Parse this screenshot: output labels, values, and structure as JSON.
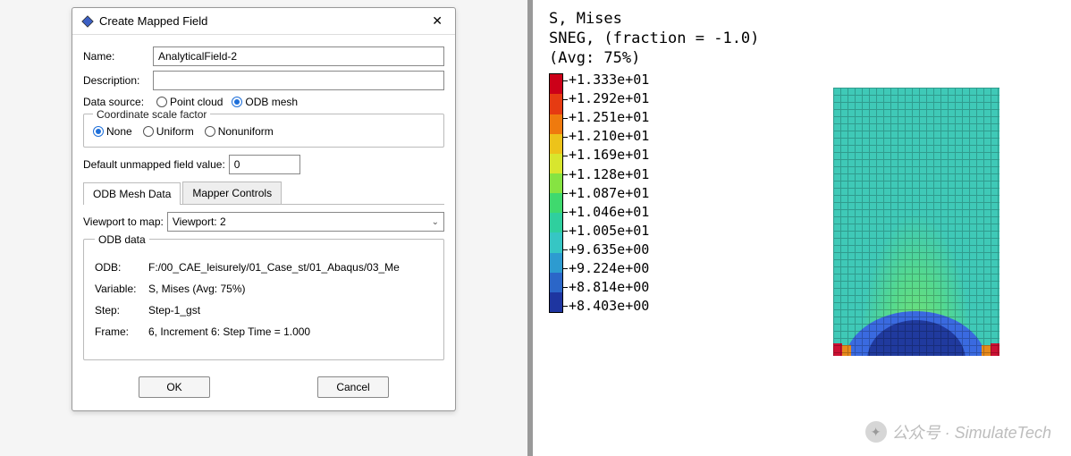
{
  "dialog": {
    "title": "Create Mapped Field",
    "name_label": "Name:",
    "name_value": "AnalyticalField-2",
    "description_label": "Description:",
    "description_value": "",
    "data_source_label": "Data source:",
    "data_source_options": {
      "point_cloud": "Point cloud",
      "odb_mesh": "ODB mesh"
    },
    "data_source_selected": "odb_mesh",
    "scale_legend": "Coordinate scale factor",
    "scale_options": {
      "none": "None",
      "uniform": "Uniform",
      "nonuniform": "Nonuniform"
    },
    "scale_selected": "none",
    "default_label": "Default unmapped field value:",
    "default_value": "0",
    "tabs": {
      "odb": "ODB Mesh Data",
      "mapper": "Mapper Controls"
    },
    "active_tab": "odb",
    "viewport_label": "Viewport to map:",
    "viewport_value": "Viewport: 2",
    "odb_section_title": "ODB data",
    "odb_rows": {
      "odb_label": "ODB:",
      "odb_value": "F:/00_CAE_leisurely/01_Case_st/01_Abaqus/03_Me",
      "variable_label": "Variable:",
      "variable_value": "S, Mises (Avg: 75%)",
      "step_label": "Step:",
      "step_value": "Step-1_gst",
      "frame_label": "Frame:",
      "frame_value": "6, Increment     6: Step Time =    1.000"
    },
    "buttons": {
      "ok": "OK",
      "cancel": "Cancel"
    }
  },
  "viewer": {
    "header_lines": [
      "S, Mises",
      "SNEG, (fraction = -1.0)",
      "(Avg: 75%)"
    ],
    "legend_values": [
      "+1.333e+01",
      "+1.292e+01",
      "+1.251e+01",
      "+1.210e+01",
      "+1.169e+01",
      "+1.128e+01",
      "+1.087e+01",
      "+1.046e+01",
      "+1.005e+01",
      "+9.635e+00",
      "+9.224e+00",
      "+8.814e+00",
      "+8.403e+00"
    ],
    "legend_colors": [
      "#cc0018",
      "#e63b12",
      "#ef7a0e",
      "#edc31a",
      "#d8e62e",
      "#86e342",
      "#3fd96e",
      "#2fcf9e",
      "#36c6c4",
      "#2d9bd0",
      "#2b66c8",
      "#1e35a0"
    ],
    "watermark": "公众号 · SimulateTech"
  },
  "chart_data": {
    "type": "heatmap",
    "title": "S, Mises",
    "subtitle": "SNEG, (fraction = -1.0) (Avg: 75%)",
    "value_range": [
      8.403,
      13.33
    ],
    "colormap_values": [
      13.33,
      12.92,
      12.51,
      12.1,
      11.69,
      11.28,
      10.87,
      10.46,
      10.05,
      9.635,
      9.224,
      8.814,
      8.403
    ],
    "colormap_colors": [
      "#cc0018",
      "#e63b12",
      "#ef7a0e",
      "#edc31a",
      "#d8e62e",
      "#86e342",
      "#3fd96e",
      "#2fcf9e",
      "#36c6c4",
      "#2d9bd0",
      "#2b66c8",
      "#1e35a0"
    ],
    "description": "Rectangular plate FEA contour; mostly ~10 (teal) with lower-value (blue ~8.4–9.2) semicircular contours at bottom center and small high-value (red ~13) at bottom corners; arch-shaped green zone rising from bottom center"
  }
}
